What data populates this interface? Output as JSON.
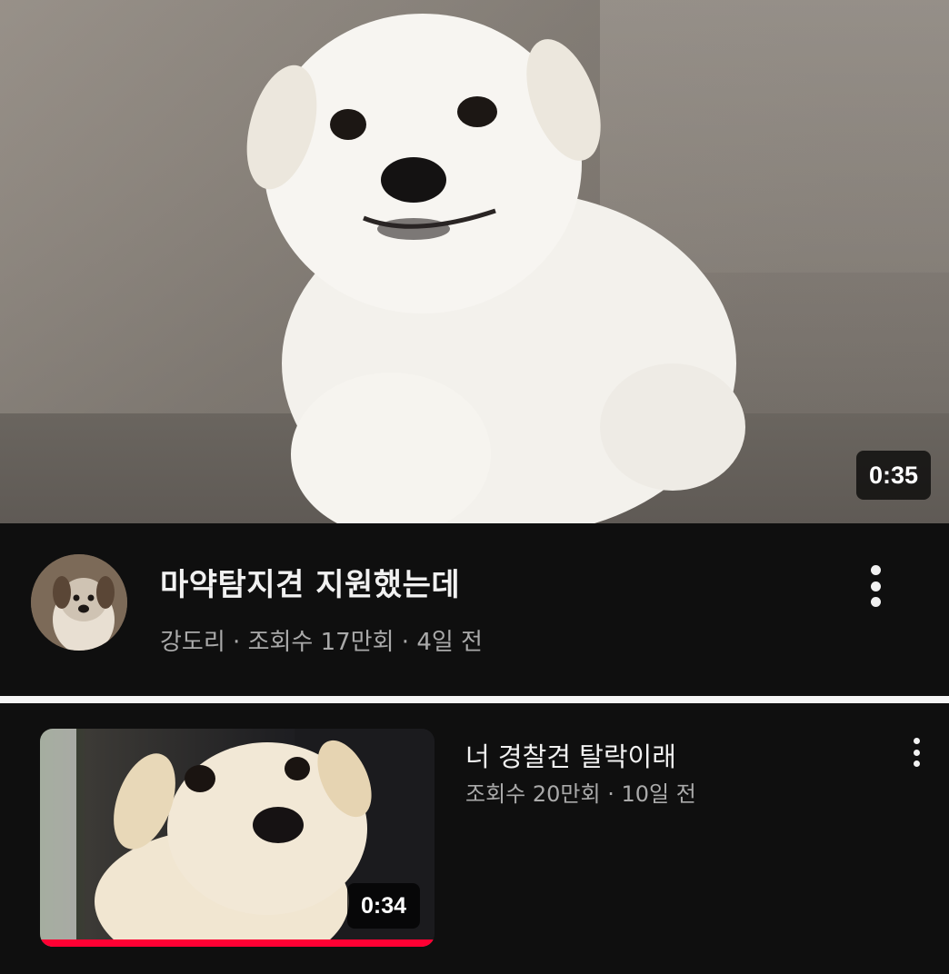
{
  "featured_video": {
    "title": "마약탐지견 지원했는데",
    "channel": "강도리",
    "views": "조회수 17만회",
    "age": "4일 전",
    "separator": " · ",
    "duration": "0:35",
    "thumbnail_subject": "white-puppy-photo",
    "menu_icon": "more-vert-icon"
  },
  "next_video": {
    "title": "너 경찰견 탈락이래",
    "views": "조회수 20만회",
    "age": "10일 전",
    "separator": " · ",
    "duration": "0:34",
    "watch_progress": 1.0,
    "thumbnail_subject": "cream-puppy-photo",
    "menu_icon": "more-vert-icon"
  },
  "colors": {
    "background": "#0f0f0f",
    "primary_text": "#f1f1f1",
    "secondary_text": "#aaaaaa",
    "progress": "#ff0033"
  }
}
